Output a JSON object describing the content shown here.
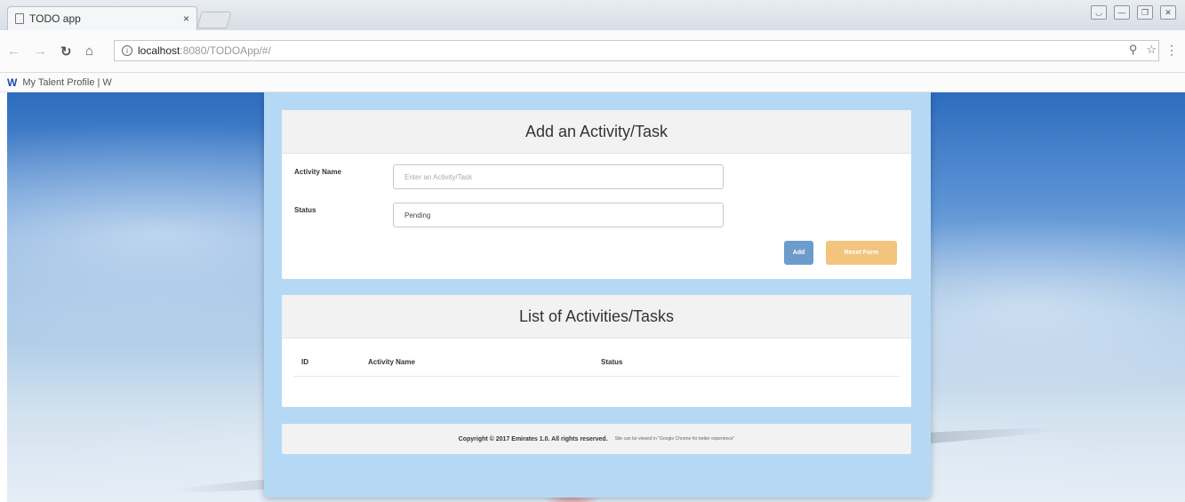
{
  "browser": {
    "tab_title": "TODO app",
    "tab_close": "×",
    "url_host": "localhost",
    "url_path": ":8080/TODOApp/#/",
    "bookmark_logo": "W",
    "bookmark_label": "My Talent Profile | W"
  },
  "icons": {
    "back": "arrow-left-icon",
    "forward": "arrow-right-icon",
    "reload": "reload-icon",
    "home": "home-icon",
    "info": "info-icon",
    "zoom": "magnifier-icon",
    "star": "star-icon",
    "menu": "menu-dots-icon"
  },
  "add_panel": {
    "heading": "Add an Activity/Task",
    "activity_label": "Activity Name",
    "activity_placeholder": "Enter an Activity/Task",
    "activity_value": "",
    "status_label": "Status",
    "status_value": "Pending",
    "add_button": "Add",
    "reset_button": "Reset Form"
  },
  "list_panel": {
    "heading": "List of Activities/Tasks",
    "columns": [
      "ID",
      "Activity Name",
      "Status"
    ],
    "rows": []
  },
  "footer": {
    "copyright": "Copyright © 2017 Emirates 1.0. All rights reserved.",
    "note": "Site can be viewed in \"Google Chrome for better experience\""
  },
  "colors": {
    "container_bg": "#b5d9f5",
    "add_button": "#6c9ccb",
    "reset_button": "#f2c47e"
  }
}
